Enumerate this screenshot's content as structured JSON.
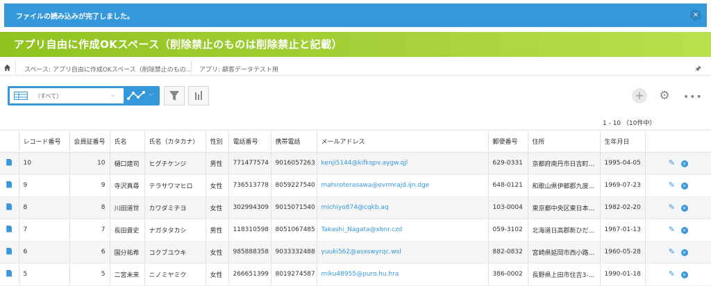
{
  "notification": {
    "message": "ファイルの読み込みが完了しました。",
    "close": "×"
  },
  "header": {
    "title": "アプリ自由に作成OKスペース（削除禁止のものは削除禁止と記載）"
  },
  "breadcrumb": {
    "space": "スペース: アプリ自由に作成OKスペース（削除禁止のもの…",
    "app": "アプリ: 顧客データテスト用"
  },
  "toolbar": {
    "view_label": "（すべて）"
  },
  "pager": {
    "text": "1 - 10 （10件中）"
  },
  "table": {
    "columns": [
      "レコード番号",
      "会員証番号",
      "氏名",
      "氏名（カタカナ）",
      "性別",
      "電話番号",
      "携帯電話",
      "メールアドレス",
      "郵便番号",
      "住所",
      "生年月日"
    ],
    "rows": [
      [
        "10",
        "10",
        "樋口建司",
        "ヒグチケンジ",
        "男性",
        "771477574",
        "9016057263",
        "kenji5144@kifkqpv.aygw.qjl",
        "629-0331",
        "京都府南丹市日吉町…",
        "1995-04-05"
      ],
      [
        "9",
        "9",
        "寺沢真尋",
        "テラサワマヒロ",
        "女性",
        "736513778",
        "8059227540",
        "mahiroterasawa@evrmrajd.ijn.dge",
        "648-0121",
        "和歌山県伊都郡九度…",
        "1969-07-23"
      ],
      [
        "8",
        "8",
        "川田道世",
        "カワダミチヨ",
        "女性",
        "302994309",
        "9015071540",
        "michiyo874@cqkb.aq",
        "103-0004",
        "東京都中央区東日本…",
        "1982-02-20"
      ],
      [
        "7",
        "7",
        "長田貴史",
        "ナガタタカシ",
        "男性",
        "118310598",
        "8051067485",
        "Takashi_Nagata@xbnr.czd",
        "059-3102",
        "北海道日高郡新ひだ…",
        "1967-01-13"
      ],
      [
        "6",
        "6",
        "国分祐希",
        "コクブユウキ",
        "女性",
        "985888358",
        "9033332488",
        "yuuki562@asxswyrqc.wsl",
        "882-0832",
        "宮崎県延岡市西小路…",
        "1960-05-28"
      ],
      [
        "5",
        "5",
        "二宮未来",
        "ニノミヤミク",
        "女性",
        "266651399",
        "8019274587",
        "miku48955@puro.hu.hra",
        "386-0002",
        "長野県上田市住吉3-…",
        "1990-01-18"
      ]
    ]
  }
}
